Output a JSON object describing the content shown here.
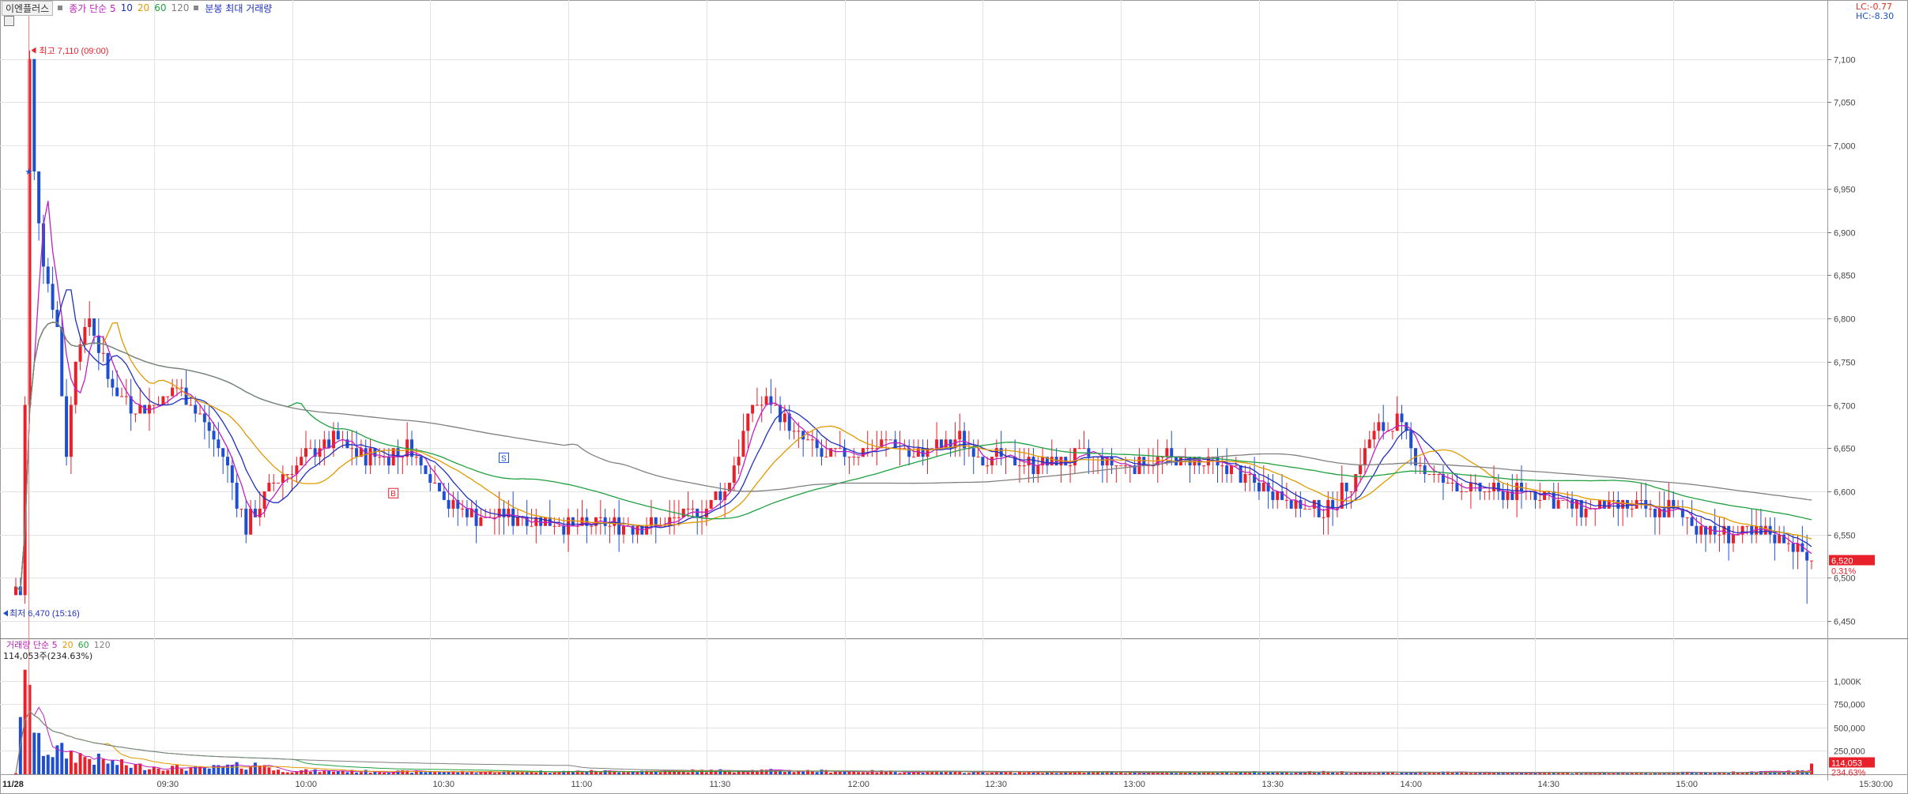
{
  "header": {
    "stock_name": "이엔플러스",
    "legend_price": [
      {
        "label": "종가 단순 5",
        "color": "#c020c0"
      },
      {
        "label": "10",
        "color": "#2030c0"
      },
      {
        "label": "20",
        "color": "#e09a00"
      },
      {
        "label": "60",
        "color": "#20a040"
      },
      {
        "label": "120",
        "color": "#808080"
      },
      {
        "label": "분봉 최대 거래량",
        "color": "#2030c0"
      }
    ],
    "lc": "LC:-0.77",
    "hc": "HC:-8.30"
  },
  "annotations": {
    "high": "최고 7,110 (09:00)",
    "low": "최저 6,470 (15:16)",
    "current_price": "6,520",
    "current_change": "0.31%",
    "date_label": "11/28",
    "buy_marker": "B",
    "sell_marker": "S"
  },
  "volume_panel": {
    "legend": [
      {
        "label": "거래량 단순 5",
        "color": "#c020c0"
      },
      {
        "label": "20",
        "color": "#e09a00"
      },
      {
        "label": "60",
        "color": "#20a040"
      },
      {
        "label": "120",
        "color": "#808080"
      }
    ],
    "info": "114,053주(234.63%)",
    "current_volume": "114,053",
    "current_ratio": "234.63%"
  },
  "colors": {
    "up": "#e8202a",
    "down": "#1f4fd0",
    "grid": "#e3e3e3",
    "axis": "#444444"
  },
  "chart_data": {
    "type": "candlestick",
    "interval": "1-minute",
    "date": "11/28",
    "price_axis": {
      "ticks": [
        "7,100",
        "7,050",
        "7,000",
        "6,950",
        "6,900",
        "6,850",
        "6,800",
        "6,750",
        "6,700",
        "6,650",
        "6,600",
        "6,550",
        "6,500",
        "6,450"
      ],
      "range": [
        6430,
        7150
      ]
    },
    "volume_axis": {
      "ticks": [
        "1,000K",
        "750,000",
        "500,000",
        "250,000"
      ],
      "range": [
        0,
        1300000
      ]
    },
    "time_axis": {
      "ticks": [
        "09:30",
        "10:00",
        "10:30",
        "11:00",
        "11:30",
        "12:00",
        "12:30",
        "13:00",
        "13:30",
        "14:00",
        "14:30",
        "15:00",
        "15:30:00"
      ]
    },
    "high": 7110,
    "low": 6470,
    "last": 6520,
    "ma_periods": [
      5,
      10,
      20,
      60,
      120
    ],
    "price_keypoints": [
      [
        0,
        6490
      ],
      [
        1,
        6480
      ],
      [
        2,
        6700
      ],
      [
        3,
        7100
      ],
      [
        4,
        6970
      ],
      [
        6,
        6870
      ],
      [
        9,
        6790
      ],
      [
        11,
        6640
      ],
      [
        13,
        6760
      ],
      [
        16,
        6800
      ],
      [
        20,
        6730
      ],
      [
        25,
        6700
      ],
      [
        30,
        6700
      ],
      [
        35,
        6720
      ],
      [
        40,
        6690
      ],
      [
        45,
        6640
      ],
      [
        50,
        6560
      ],
      [
        55,
        6600
      ],
      [
        60,
        6630
      ],
      [
        65,
        6650
      ],
      [
        70,
        6660
      ],
      [
        75,
        6640
      ],
      [
        80,
        6640
      ],
      [
        85,
        6650
      ],
      [
        90,
        6620
      ],
      [
        95,
        6580
      ],
      [
        100,
        6570
      ],
      [
        110,
        6570
      ],
      [
        120,
        6560
      ],
      [
        130,
        6560
      ],
      [
        140,
        6560
      ],
      [
        150,
        6580
      ],
      [
        155,
        6610
      ],
      [
        160,
        6700
      ],
      [
        165,
        6700
      ],
      [
        170,
        6660
      ],
      [
        175,
        6640
      ],
      [
        180,
        6640
      ],
      [
        185,
        6650
      ],
      [
        190,
        6660
      ],
      [
        195,
        6640
      ],
      [
        200,
        6650
      ],
      [
        205,
        6660
      ],
      [
        210,
        6640
      ],
      [
        220,
        6630
      ],
      [
        230,
        6640
      ],
      [
        240,
        6630
      ],
      [
        250,
        6640
      ],
      [
        260,
        6630
      ],
      [
        270,
        6610
      ],
      [
        280,
        6580
      ],
      [
        285,
        6580
      ],
      [
        290,
        6610
      ],
      [
        295,
        6670
      ],
      [
        300,
        6680
      ],
      [
        305,
        6630
      ],
      [
        310,
        6610
      ],
      [
        320,
        6600
      ],
      [
        330,
        6600
      ],
      [
        340,
        6580
      ],
      [
        350,
        6580
      ],
      [
        360,
        6580
      ],
      [
        365,
        6560
      ],
      [
        370,
        6550
      ],
      [
        380,
        6550
      ],
      [
        385,
        6540
      ],
      [
        390,
        6520
      ]
    ],
    "volume_keypoints": [
      [
        0,
        15000
      ],
      [
        3,
        1300000
      ],
      [
        4,
        450000
      ],
      [
        5,
        300000
      ],
      [
        8,
        250000
      ],
      [
        12,
        220000
      ],
      [
        18,
        150000
      ],
      [
        25,
        90000
      ],
      [
        40,
        60000
      ],
      [
        55,
        110000
      ],
      [
        56,
        40000
      ],
      [
        80,
        30000
      ],
      [
        100,
        25000
      ],
      [
        160,
        40000
      ],
      [
        200,
        25000
      ],
      [
        250,
        20000
      ],
      [
        290,
        25000
      ],
      [
        300,
        20000
      ],
      [
        350,
        15000
      ],
      [
        370,
        20000
      ],
      [
        389,
        30000
      ],
      [
        390,
        114053
      ]
    ]
  }
}
